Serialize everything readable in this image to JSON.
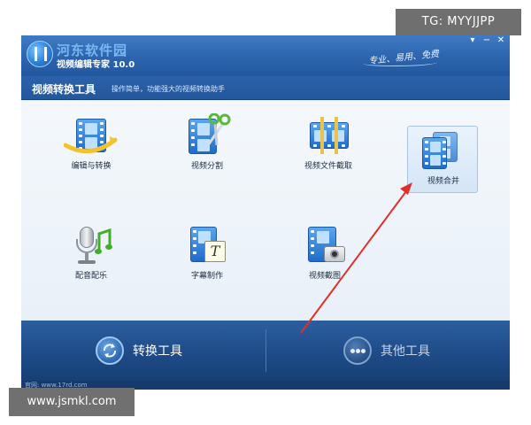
{
  "app": {
    "logo_text": "河东软件园",
    "title": "视频编辑专家 10.0",
    "slogan": "专业、易用、免费"
  },
  "subbar": {
    "title": "视频转换工具",
    "description": "操作简单，功能强大的视频转换助手"
  },
  "tools": [
    {
      "label": "编辑与转换",
      "icon": "convert-film-icon"
    },
    {
      "label": "视频分割",
      "icon": "scissors-film-icon"
    },
    {
      "label": "视频文件截取",
      "icon": "clip-film-icon"
    },
    {
      "label": "视频合并",
      "icon": "merge-film-icon",
      "selected": true
    },
    {
      "label": "配音配乐",
      "icon": "microphone-icon"
    },
    {
      "label": "字幕制作",
      "icon": "subtitle-icon"
    },
    {
      "label": "视频截图",
      "icon": "camera-film-icon"
    }
  ],
  "bottom_tabs": {
    "convert_label": "转换工具",
    "other_label": "其他工具"
  },
  "statusbar": {
    "text": "官网: www.17rd.com"
  },
  "watermarks": {
    "top": "TG: MYYJJPP",
    "bottom": "www.jsmkl.com"
  },
  "colors": {
    "titlebar": "#2c64ad",
    "annotation_arrow": "#e0302a"
  }
}
